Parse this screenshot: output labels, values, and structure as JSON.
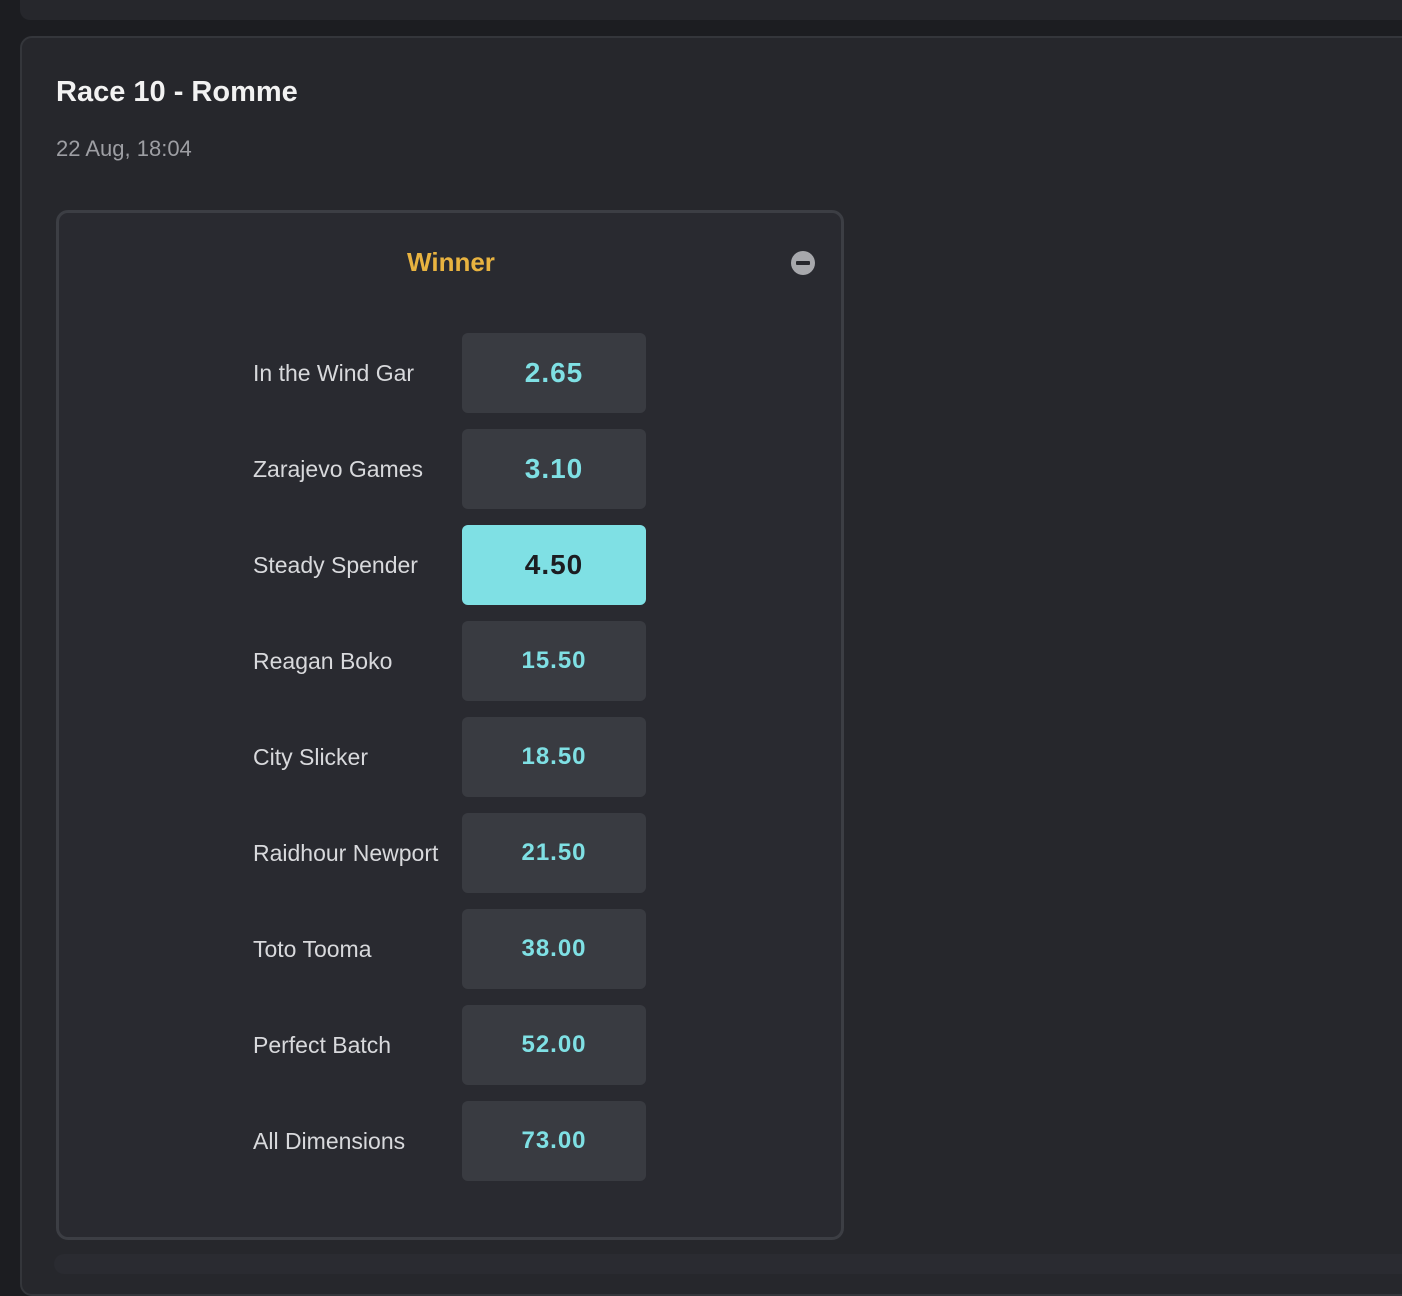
{
  "race": {
    "title": "Race 10 - Romme",
    "time": "22 Aug, 18:04"
  },
  "market": {
    "title": "Winner",
    "collapse_icon": "minus-circle-icon",
    "runners": [
      {
        "name": "In the Wind Gar",
        "odds": "2.65",
        "selected": false
      },
      {
        "name": "Zarajevo Games",
        "odds": "3.10",
        "selected": false
      },
      {
        "name": "Steady Spender",
        "odds": "4.50",
        "selected": true
      },
      {
        "name": "Reagan Boko",
        "odds": "15.50",
        "selected": false
      },
      {
        "name": "City Slicker",
        "odds": "18.50",
        "selected": false
      },
      {
        "name": "Raidhour Newport",
        "odds": "21.50",
        "selected": false
      },
      {
        "name": "Toto Tooma",
        "odds": "38.00",
        "selected": false
      },
      {
        "name": "Perfect Batch",
        "odds": "52.00",
        "selected": false
      },
      {
        "name": "All Dimensions",
        "odds": "73.00",
        "selected": false
      }
    ]
  },
  "colors": {
    "accent_odds": "#7fe0e4",
    "market_title": "#e8b340",
    "background": "#1c1d21",
    "card": "#26272c"
  }
}
